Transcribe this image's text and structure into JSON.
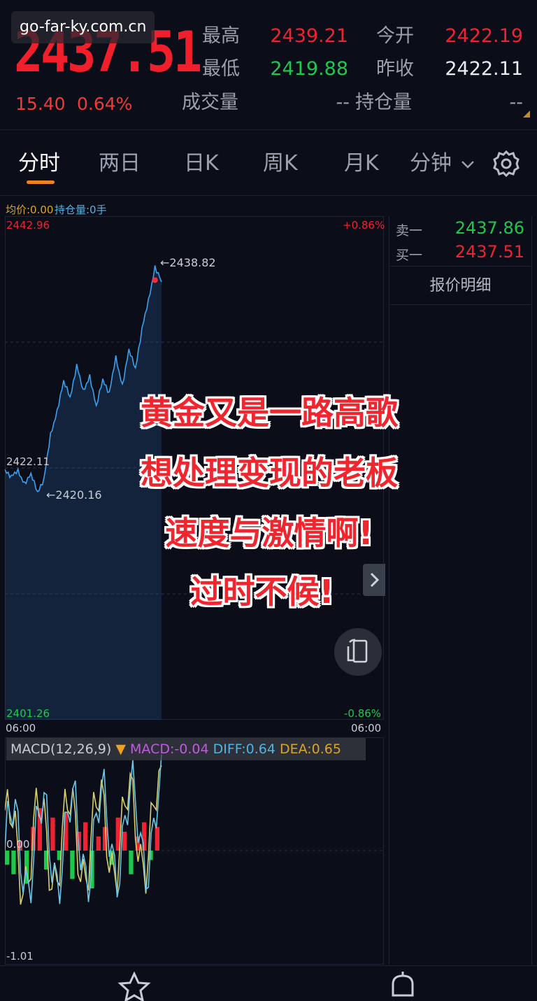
{
  "header": {
    "watermark": "go-far-ky.com.cn",
    "price": "2437.51",
    "change": "15.40",
    "change_pct": "0.64%",
    "high_label": "最高",
    "high_value": "2439.21",
    "open_label": "今开",
    "open_value": "2422.19",
    "low_label": "最低",
    "low_value": "2419.88",
    "prev_close_label": "昨收",
    "prev_close_value": "2422.11",
    "volume_label": "成交量",
    "volume_value": "--",
    "open_interest_label": "持仓量",
    "open_interest_value": "--"
  },
  "tabs": [
    {
      "label": "分时",
      "active": true
    },
    {
      "label": "两日",
      "active": false
    },
    {
      "label": "日K",
      "active": false
    },
    {
      "label": "周K",
      "active": false
    },
    {
      "label": "月K",
      "active": false
    },
    {
      "label": "分钟",
      "active": false,
      "dropdown": true
    }
  ],
  "chart": {
    "avg_legend": "均价:0.00",
    "hold_legend": "持仓量:0手",
    "top_price": "2442.96",
    "top_pct": "+0.86%",
    "mid_price": "2422.11",
    "bottom_price": "2401.26",
    "bottom_pct": "-0.86%",
    "time_start": "06:00",
    "time_end": "06:00",
    "high_callout": "←2438.82",
    "low_callout": "←2420.16"
  },
  "book": {
    "sell_label": "卖一",
    "sell_value": "2437.86",
    "buy_label": "买一",
    "buy_value": "2437.51",
    "detail_label": "报价明细"
  },
  "caption": {
    "line1": "黄金又是一路高歌",
    "line2": "想处理变现的老板",
    "line3": "速度与激情啊!",
    "line4": "过时不候!"
  },
  "macd": {
    "title": "MACD(12,26,9)",
    "arrow": "▼",
    "macd": "MACD:-0.04",
    "diff": "DIFF:0.64",
    "dea": "DEA:0.65",
    "zero_label": "0.00",
    "bottom_label": "-1.01"
  },
  "colors": {
    "up": "#ef2232",
    "down": "#1ec84c",
    "price_line": "#3aa0f0",
    "diff_line": "#6ac7e8",
    "dea_line": "#d8d06a",
    "macd_label": "#c05ae0",
    "accent": "#f0821e"
  },
  "chart_data": {
    "type": "line",
    "price_series": [
      2422.0,
      2421.4,
      2421.8,
      2420.9,
      2421.5,
      2420.16,
      2421.2,
      2424.8,
      2426.9,
      2429.2,
      2428.0,
      2430.6,
      2428.4,
      2429.8,
      2427.1,
      2429.5,
      2428.3,
      2431.2,
      2429.0,
      2431.8,
      2430.4,
      2433.6,
      2435.9,
      2438.82,
      2437.51
    ],
    "ylim": [
      2401.26,
      2442.96
    ],
    "macd_hist": [
      -0.3,
      -0.5,
      0.2,
      -0.7,
      0.5,
      0.9,
      -0.4,
      0.7,
      -0.2,
      0.8,
      -0.6,
      0.4,
      0.6,
      -0.8,
      0.3,
      0.5,
      -0.3,
      0.7,
      0.4,
      -0.5,
      0.3,
      0.6,
      -0.2,
      0.5
    ],
    "macd_ylim": [
      -1.01,
      1.01
    ]
  }
}
